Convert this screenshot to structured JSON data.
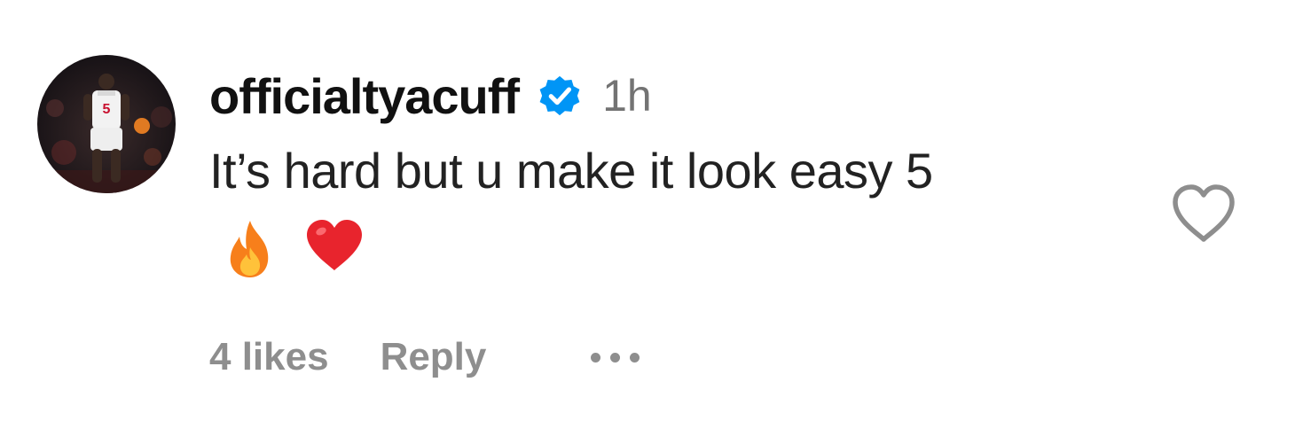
{
  "comment": {
    "username": "officialtyacuff",
    "timestamp": "1h",
    "text": "It’s hard but u make it look easy 5",
    "emojis": [
      "fire-emoji",
      "red-heart-emoji"
    ],
    "likes_label": "4 likes",
    "reply_label": "Reply",
    "verified_color": "#0095f6",
    "muted_color": "#8e8e8e"
  }
}
